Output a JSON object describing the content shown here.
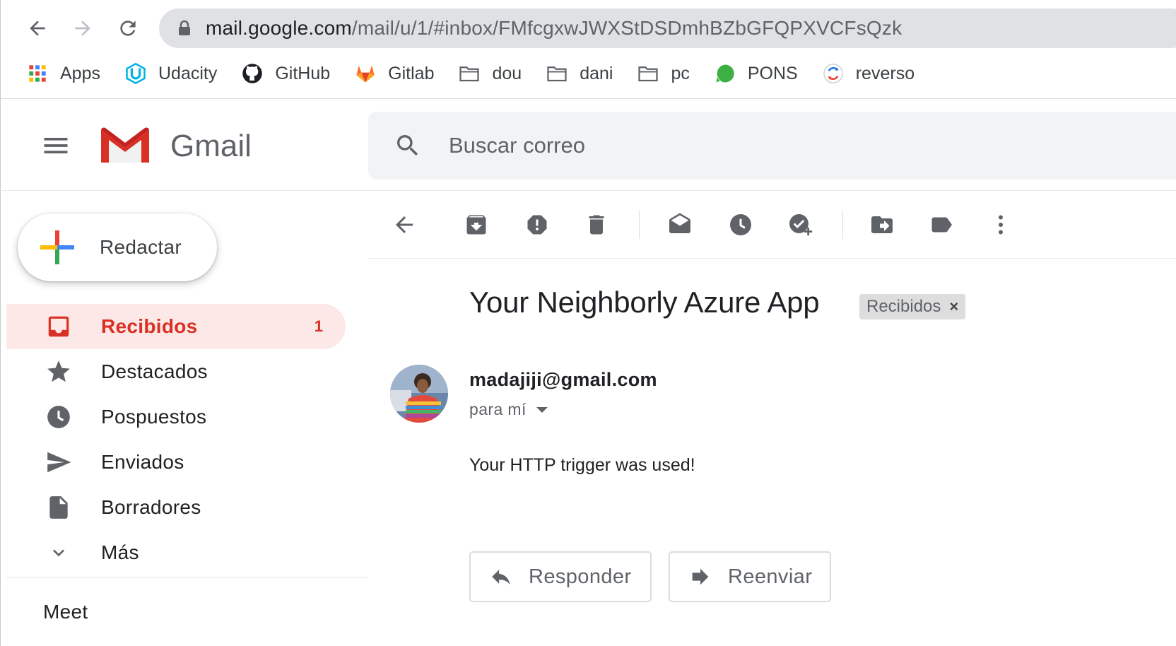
{
  "browser": {
    "url_host": "mail.google.com",
    "url_path": "/mail/u/1/#inbox/FMfcgxwJWXStDSDmhBZbGFQPXVCFsQzk",
    "bookmarks": [
      {
        "label": "Apps",
        "icon": "apps-grid-icon"
      },
      {
        "label": "Udacity",
        "icon": "udacity-icon"
      },
      {
        "label": "GitHub",
        "icon": "github-icon"
      },
      {
        "label": "Gitlab",
        "icon": "gitlab-icon"
      },
      {
        "label": "dou",
        "icon": "folder-icon"
      },
      {
        "label": "dani",
        "icon": "folder-icon"
      },
      {
        "label": "pc",
        "icon": "folder-icon"
      },
      {
        "label": "PONS",
        "icon": "pons-icon"
      },
      {
        "label": "reverso",
        "icon": "reverso-icon"
      }
    ]
  },
  "gmail": {
    "brand": "Gmail",
    "search_placeholder": "Buscar correo"
  },
  "sidebar": {
    "compose_label": "Redactar",
    "items": [
      {
        "label": "Recibidos",
        "count": "1",
        "icon": "inbox-icon",
        "active": true
      },
      {
        "label": "Destacados",
        "icon": "star-icon"
      },
      {
        "label": "Pospuestos",
        "icon": "clock-icon"
      },
      {
        "label": "Enviados",
        "icon": "send-icon"
      },
      {
        "label": "Borradores",
        "icon": "draft-icon"
      },
      {
        "label": "Más",
        "icon": "chevron-down-icon"
      }
    ],
    "meet_label": "Meet"
  },
  "message": {
    "subject": "Your Neighborly Azure App",
    "label_chip": "Recibidos",
    "label_chip_close": "×",
    "sender": "madajiji@gmail.com",
    "recipient": "para mí",
    "body": "Your HTTP trigger was used!",
    "reply_label": "Responder",
    "forward_label": "Reenviar"
  },
  "colors": {
    "accent_red": "#d93025",
    "active_bg": "#fce8e6"
  }
}
